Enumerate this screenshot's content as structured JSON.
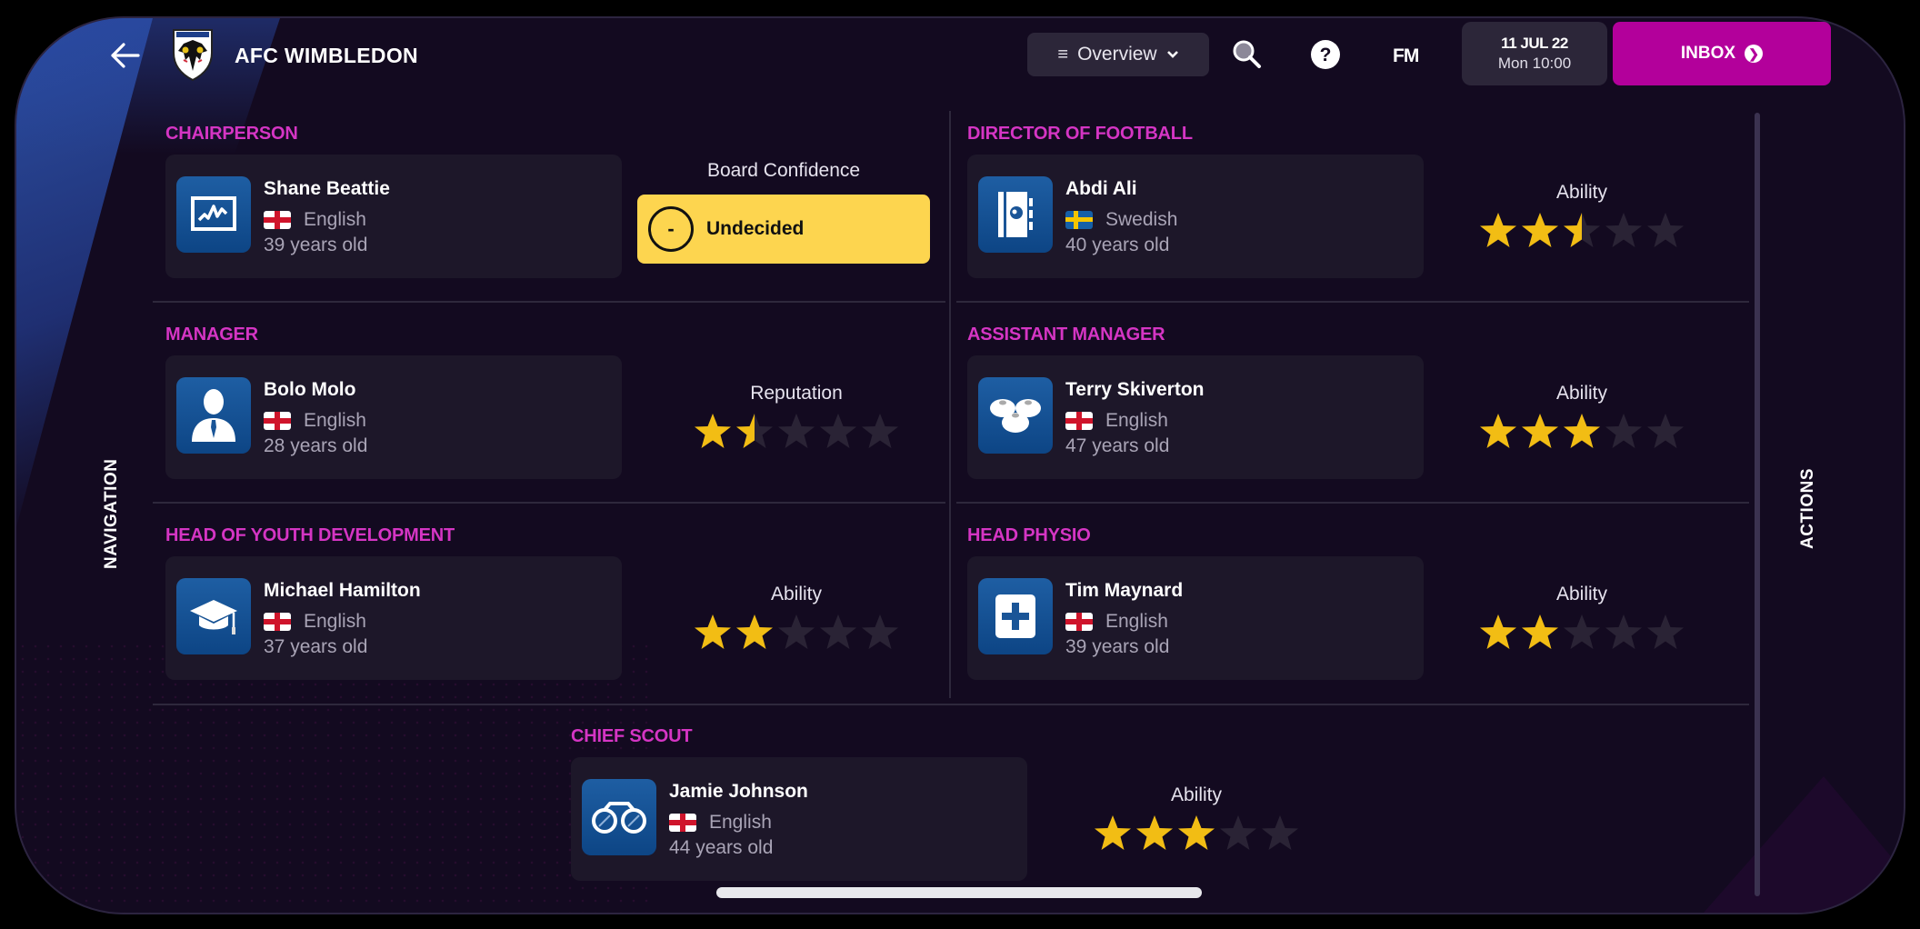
{
  "header": {
    "club_name": "AFC WIMBLEDON",
    "view_selector": "Overview",
    "fm_label": "FM",
    "date": "11 JUL 22",
    "time": "Mon 10:00",
    "inbox_label": "INBOX"
  },
  "side": {
    "navigation_label": "NAVIGATION",
    "actions_label": "ACTIONS"
  },
  "colors": {
    "accent_magenta": "#d535c4",
    "inbox_bg": "#b3009b",
    "board_confidence_bg": "#fdd54f",
    "star_filled": "#f2bd14",
    "star_empty": "#2a2335"
  },
  "staff": [
    {
      "role": "CHAIRPERSON",
      "name": "Shane Beattie",
      "nationality": "English",
      "flag": "england",
      "age": "39 years old",
      "avatar_icon": "chart-monitor-icon",
      "metric_label": "Board Confidence",
      "metric_type": "status",
      "status": "Undecided",
      "status_symbol": "-"
    },
    {
      "role": "DIRECTOR OF FOOTBALL",
      "name": "Abdi Ali",
      "nationality": "Swedish",
      "flag": "sweden",
      "age": "40 years old",
      "avatar_icon": "notebook-icon",
      "metric_label": "Ability",
      "metric_type": "stars",
      "stars": 2.5,
      "max_stars": 5
    },
    {
      "role": "MANAGER",
      "name": "Bolo Molo",
      "nationality": "English",
      "flag": "england",
      "age": "28 years old",
      "avatar_icon": "manager-silhouette-icon",
      "metric_label": "Reputation",
      "metric_type": "stars",
      "stars": 1.5,
      "max_stars": 5
    },
    {
      "role": "ASSISTANT MANAGER",
      "name": "Terry Skiverton",
      "nationality": "English",
      "flag": "england",
      "age": "47 years old",
      "avatar_icon": "training-cones-icon",
      "metric_label": "Ability",
      "metric_type": "stars",
      "stars": 3,
      "max_stars": 5
    },
    {
      "role": "HEAD OF YOUTH DEVELOPMENT",
      "name": "Michael Hamilton",
      "nationality": "English",
      "flag": "england",
      "age": "37 years old",
      "avatar_icon": "graduation-cap-icon",
      "metric_label": "Ability",
      "metric_type": "stars",
      "stars": 2,
      "max_stars": 5
    },
    {
      "role": "HEAD PHYSIO",
      "name": "Tim Maynard",
      "nationality": "English",
      "flag": "england",
      "age": "39 years old",
      "avatar_icon": "medical-cross-icon",
      "metric_label": "Ability",
      "metric_type": "stars",
      "stars": 2,
      "max_stars": 5
    },
    {
      "role": "CHIEF SCOUT",
      "name": "Jamie Johnson",
      "nationality": "English",
      "flag": "england",
      "age": "44 years old",
      "avatar_icon": "binoculars-icon",
      "metric_label": "Ability",
      "metric_type": "stars",
      "stars": 3,
      "max_stars": 5
    }
  ]
}
